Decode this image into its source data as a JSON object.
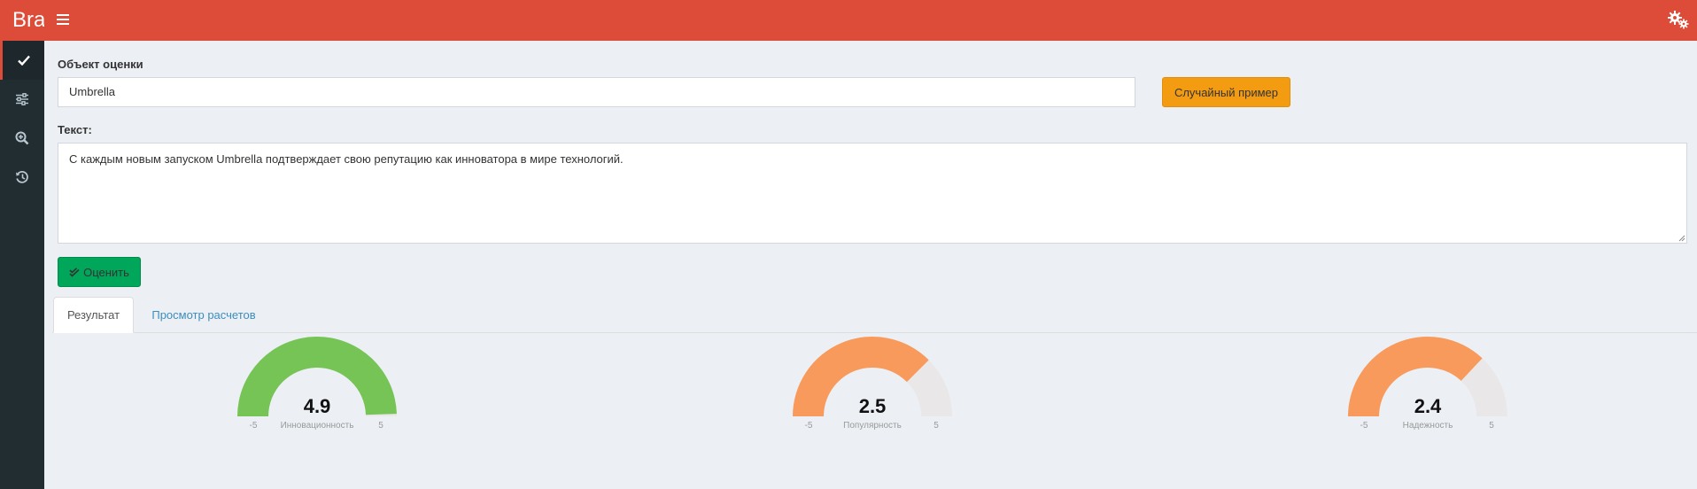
{
  "header": {
    "brand": "Brand",
    "menu_icon": "hamburger-icon",
    "settings_icon": "gears-icon",
    "color": "#dd4b39"
  },
  "sidebar": {
    "items": [
      {
        "icon": "check-icon",
        "active": true
      },
      {
        "icon": "sliders-icon",
        "active": false
      },
      {
        "icon": "search-plus-icon",
        "active": false
      },
      {
        "icon": "history-icon",
        "active": false
      }
    ]
  },
  "form": {
    "object_label": "Объект оценки",
    "object_value": "Umbrella",
    "random_button": "Случайный пример",
    "text_label": "Текст:",
    "text_value": "С каждым новым запуском Umbrella подтверждает свою репутацию как инноватора в мире технологий.",
    "evaluate_button": "Оценить"
  },
  "tabs": [
    {
      "label": "Результат",
      "active": true
    },
    {
      "label": "Просмотр расчетов",
      "active": false
    }
  ],
  "gauges": [
    {
      "value": 4.9,
      "value_text": "4.9",
      "label": "Инновационность",
      "min": "-5",
      "max": "5",
      "color": "#76c456"
    },
    {
      "value": 2.5,
      "value_text": "2.5",
      "label": "Популярность",
      "min": "-5",
      "max": "5",
      "color": "#f89a5b"
    },
    {
      "value": 2.4,
      "value_text": "2.4",
      "label": "Надежность",
      "min": "-5",
      "max": "5",
      "color": "#f89a5b"
    }
  ]
}
